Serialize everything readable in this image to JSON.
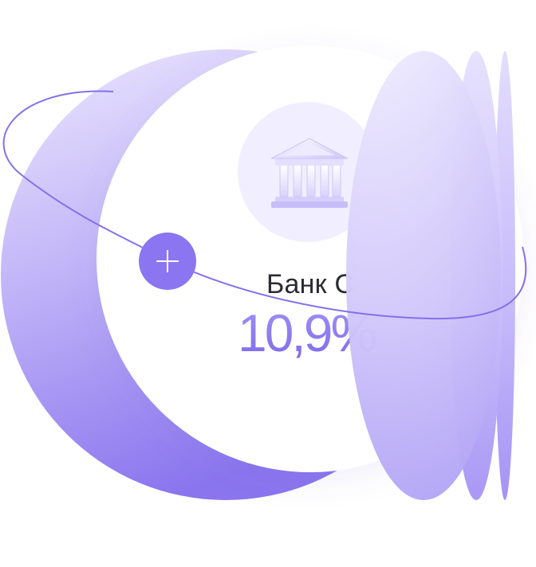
{
  "card": {
    "title": "Банк С",
    "rate": "10,9%"
  },
  "icons": {
    "bank": "bank-building-icon",
    "plus": "plus-icon"
  },
  "colors": {
    "accent": "#8b75f0",
    "accent_deep": "#7b66e8",
    "lavender_light": "#ebe7fe",
    "lavender_mid": "#c8bcf9",
    "icon_circle": "#f1efff",
    "text_dark": "#2b2b33"
  }
}
